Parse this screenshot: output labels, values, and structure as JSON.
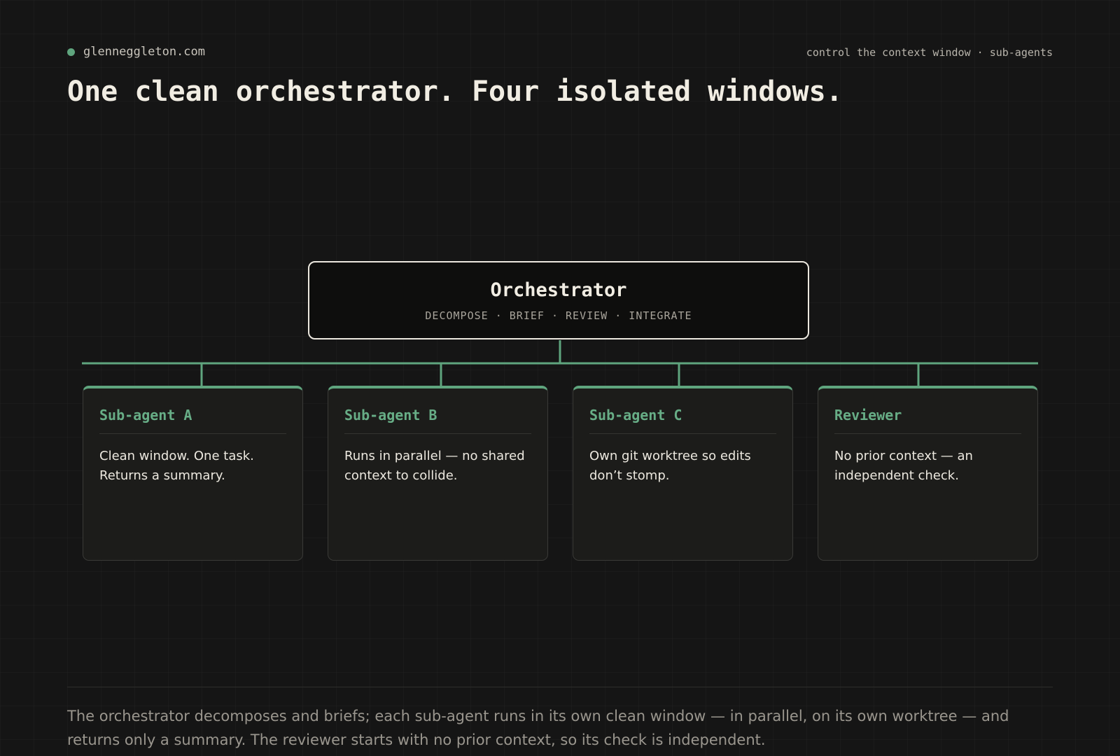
{
  "header": {
    "site": "glenneggleton.com",
    "topic": "control the context window · sub-agents",
    "title": "One clean orchestrator. Four isolated windows."
  },
  "colors": {
    "background": "#151515",
    "accent": "#5fa57e",
    "text": "#ece8df",
    "muted": "#9a968e"
  },
  "diagram": {
    "orchestrator": {
      "title": "Orchestrator",
      "roles": "DECOMPOSE · BRIEF · REVIEW · INTEGRATE"
    },
    "agents": [
      {
        "title": "Sub-agent A",
        "body": "Clean window. One task. Returns a summary."
      },
      {
        "title": "Sub-agent B",
        "body": "Runs in parallel — no shared context to collide."
      },
      {
        "title": "Sub-agent C",
        "body": "Own git worktree so edits don’t stomp."
      },
      {
        "title": "Reviewer",
        "body": "No prior context — an independent check."
      }
    ]
  },
  "footer": {
    "caption": "The orchestrator decomposes and briefs; each sub-agent runs in its own clean window — in parallel, on its own worktree — and returns only a summary. The reviewer starts with no prior context, so its check is independent."
  }
}
